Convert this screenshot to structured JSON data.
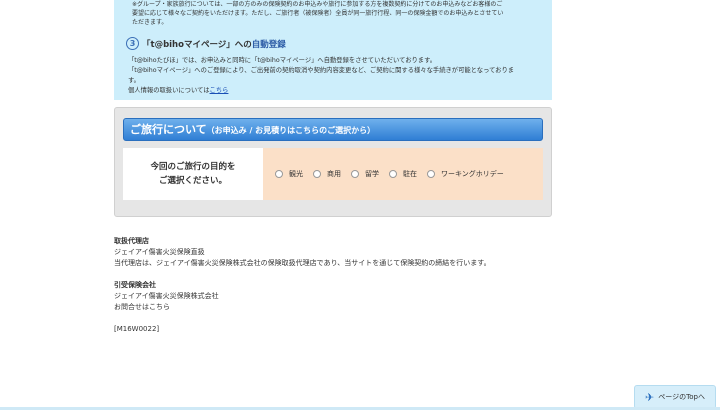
{
  "notice": {
    "note_lines": [
      "※グループ・家族旅行については、一部の方のみの保険契約のお申込みや旅行に参加する方を複数契約に分けてのお申込みなどお客様のご",
      "要望に応じて様々なご契約をいただけます。ただし、ご旅行者（被保険者）全員が同一旅行行程、同一の保険金額でのお申込みとさせてい",
      "ただきます。"
    ],
    "step3": {
      "number": "3",
      "title_prefix": "「t@bihoマイページ」への",
      "title_accent": "自動登録"
    },
    "step3_lines": [
      "「t@bihoたびほ」では、お申込みと同時に「t@bihoマイページ」へ自動登録をさせていただいております。",
      "「t@bihoマイページ」へのご登録により、ご出発前の契約取消や契約内容変更など、ご契約に関する様々な手続きが可能となっておりま",
      "す。"
    ],
    "privacy_text": "個人情報の取扱いについては",
    "privacy_link": "こちら"
  },
  "travel": {
    "header_main": "ご旅行について",
    "header_sub": "（お申込み / お見積りはこちらのご選択から）",
    "purpose_label_line1": "今回のご旅行の目的を",
    "purpose_label_line2": "ご選択ください。",
    "options": [
      "観光",
      "商用",
      "留学",
      "駐在",
      "ワーキングホリデー"
    ]
  },
  "footer": {
    "agency_head": "取扱代理店",
    "agency_name": "ジェイアイ傷害火災保険直扱",
    "agency_desc": "当代理店は、ジェイアイ傷害火災保険株式会社の保険取扱代理店であり、当サイトを通じて保険契約の締結を行います。",
    "insurer_head": "引受保険会社",
    "insurer_name": "ジェイアイ傷害火災保険株式会社",
    "contact": "お問合せはこちら",
    "code": "[M16W0022]"
  },
  "page_top": {
    "label": "ページのTopへ",
    "icon": "airplane-icon"
  },
  "colors": {
    "notice_bg": "#cdeefb",
    "header_blue": "#2f7ed4",
    "options_bg": "#fbe0c8"
  }
}
